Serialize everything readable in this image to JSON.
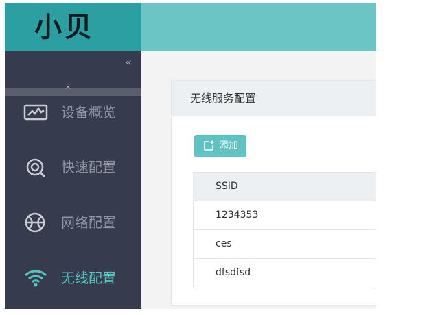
{
  "sidebar": {
    "logo": "小贝",
    "collapse_icon": "«",
    "scroll_up_icon": "^",
    "items": [
      {
        "label": "设备概览",
        "icon": "monitor-chart-icon",
        "active": false
      },
      {
        "label": "快速配置",
        "icon": "quick-config-icon",
        "active": false
      },
      {
        "label": "网络配置",
        "icon": "globe-network-icon",
        "active": false
      },
      {
        "label": "无线配置",
        "icon": "wifi-icon",
        "active": true
      }
    ]
  },
  "panel": {
    "title": "无线服务配置",
    "add_button": {
      "label": "添加",
      "icon": "add-icon"
    },
    "table": {
      "header": "SSID",
      "rows": [
        "1234353",
        "ces",
        "dfsdfsd"
      ]
    }
  },
  "colors": {
    "brand": "#2aa0a3",
    "header": "#6ac5c4",
    "sidebar_bg": "#363b4d",
    "active": "#56c5c2",
    "button": "#5fc3c1"
  }
}
